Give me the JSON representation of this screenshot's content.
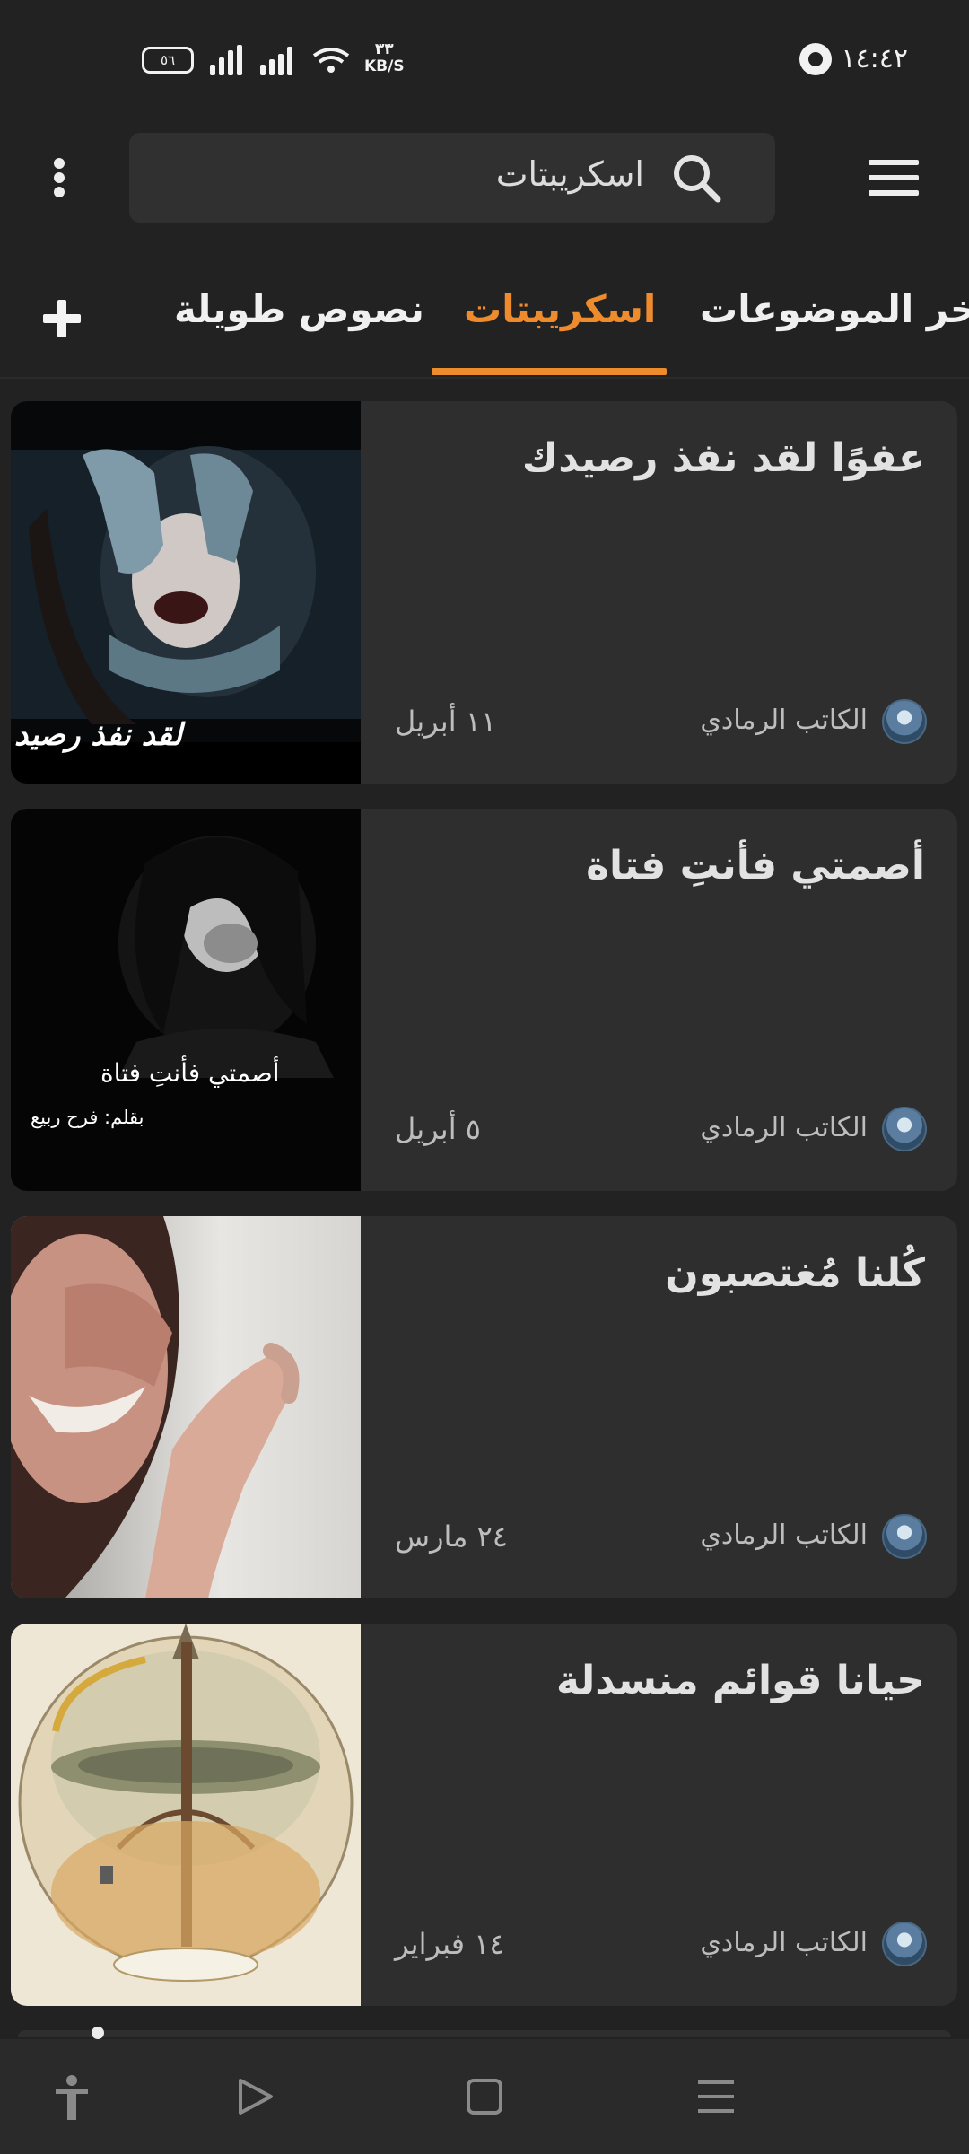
{
  "status_bar": {
    "time": "١٤:٤٢",
    "battery": "٥٦",
    "net_speed_value": "٣٣",
    "net_speed_unit": "KB/S",
    "icons": [
      "whatsapp-icon",
      "battery-icon",
      "signal-icon",
      "wifi-icon"
    ]
  },
  "app_bar": {
    "search_text": "اسكريبتات",
    "icons": [
      "more-vert-icon",
      "search-icon",
      "hamburger-menu-icon"
    ]
  },
  "tabs": {
    "items": [
      {
        "label": "اخر الموضوعات",
        "active": false
      },
      {
        "label": "اسكريبتات",
        "active": true
      },
      {
        "label": "نصوص طويلة",
        "active": false
      }
    ],
    "add_icon": "plus-icon"
  },
  "colors": {
    "background": "#222223",
    "card": "#2e2e2f",
    "accent": "#ee8b2c"
  },
  "cards": [
    {
      "title": "عفوًا لقد نفذ رصيدك",
      "author": "الكاتب الرمادي",
      "date": "١١ أبريل",
      "thumb_caption": "لقد نفذ رصيد"
    },
    {
      "title": "أصمتي فأنتِ فتاة",
      "author": "الكاتب الرمادي",
      "date": "٥ أبريل",
      "thumb_caption": "أصمتي فأنتِ فتاة",
      "thumb_byline": "بقلم: فرح ربيع"
    },
    {
      "title": "كُلنا مُغتصبون",
      "author": "الكاتب الرمادي",
      "date": "٢٤ مارس"
    },
    {
      "title": "حيانا قوائم منسدلة",
      "author": "الكاتب الرمادي",
      "date": "١٤ فبراير"
    }
  ],
  "nav_bar": {
    "icons": [
      "accessibility-icon",
      "back-triangle-icon",
      "home-square-icon",
      "recents-menu-icon"
    ]
  }
}
